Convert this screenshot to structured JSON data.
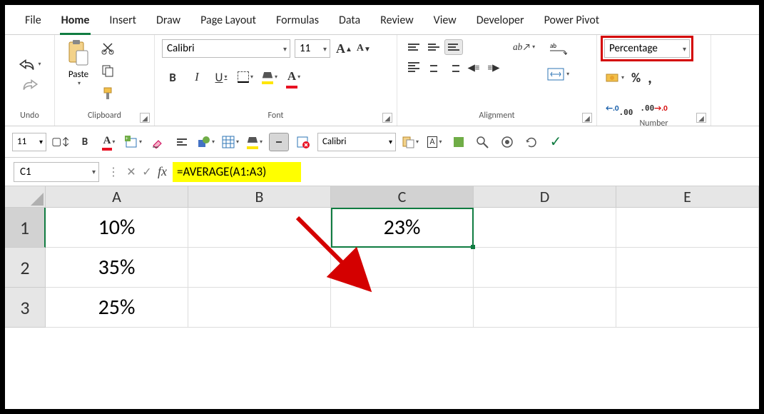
{
  "tabs": {
    "file": "File",
    "home": "Home",
    "insert": "Insert",
    "draw": "Draw",
    "page_layout": "Page Layout",
    "formulas": "Formulas",
    "data": "Data",
    "review": "Review",
    "view": "View",
    "developer": "Developer",
    "power_pivot": "Power Pivot"
  },
  "ribbon": {
    "undo_label": "Undo",
    "clipboard_label": "Clipboard",
    "paste_label": "Paste",
    "font_label": "Font",
    "font_name": "Calibri",
    "font_size": "11",
    "bold": "B",
    "italic": "I",
    "underline": "U",
    "alignment_label": "Alignment",
    "number_label": "Number",
    "number_format": "Percentage",
    "percent_sign": "%",
    "comma_sign": ",",
    "inc_dec": "←.0\n.00",
    "dec_dec": ".00\n→.0"
  },
  "qat": {
    "font_size": "11",
    "bold": "B",
    "font_color": "A",
    "font_name": "Calibri",
    "box_letter": "A"
  },
  "formula_bar": {
    "name_box": "C1",
    "fx": "fx",
    "formula": "=AVERAGE(A1:A3)"
  },
  "grid": {
    "col_headers": [
      "A",
      "B",
      "C",
      "D",
      "E"
    ],
    "row_headers": [
      "1",
      "2",
      "3"
    ],
    "cells": {
      "A1": "10%",
      "A2": "35%",
      "A3": "25%",
      "C1": "23%"
    },
    "active": "C1"
  }
}
